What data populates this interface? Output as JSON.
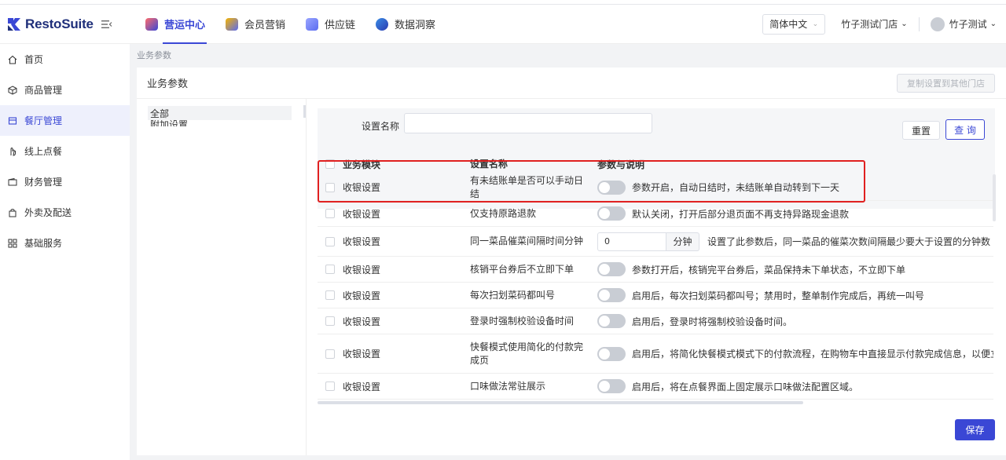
{
  "brand": {
    "name": "RestoSuite"
  },
  "nav": [
    {
      "label": "营运中心",
      "icon": "operations-icon",
      "color": "#3a47d5",
      "active": true
    },
    {
      "label": "会员营销",
      "icon": "member-icon",
      "color": "#f5b400",
      "active": false
    },
    {
      "label": "供应链",
      "icon": "supply-icon",
      "color": "#5b6cf0",
      "active": false
    },
    {
      "label": "数据洞察",
      "icon": "data-icon",
      "color": "#3a8ee6",
      "active": false
    }
  ],
  "header": {
    "language": "简体中文",
    "store": "竹子测试门店",
    "user": "竹子测试"
  },
  "sidebar": {
    "items": [
      {
        "label": "首页",
        "icon": "home-icon"
      },
      {
        "label": "商品管理",
        "icon": "cube-icon"
      },
      {
        "label": "餐厅管理",
        "icon": "restaurant-icon",
        "active": true
      },
      {
        "label": "线上点餐",
        "icon": "hand-icon"
      },
      {
        "label": "财务管理",
        "icon": "wallet-icon"
      },
      {
        "label": "外卖及配送",
        "icon": "bag-icon"
      },
      {
        "label": "基础服务",
        "icon": "grid-icon"
      }
    ]
  },
  "breadcrumb": "业务参数",
  "panel": {
    "title": "业务参数",
    "copy_button": "复制设置到其他门店"
  },
  "categories": {
    "all": "全部",
    "second": "附加设置"
  },
  "filter": {
    "label": "设置名称",
    "input_value": "",
    "reset": "重置",
    "query": "查 询"
  },
  "table": {
    "headers": {
      "module": "业务模块",
      "name": "设置名称",
      "desc": "参数与说明"
    },
    "rows": [
      {
        "module": "收银设置",
        "name": "有未结账单是否可以手动日结",
        "desc": "参数开启，自动日结时，未结账单自动转到下一天",
        "type": "toggle"
      },
      {
        "module": "收银设置",
        "name": "仅支持原路退款",
        "desc": "默认关闭，打开后部分退页面不再支持异路现金退款",
        "type": "toggle"
      },
      {
        "module": "收银设置",
        "name": "同一菜品催菜间隔时间分钟",
        "desc": "设置了此参数后，同一菜品的催菜次数间隔最少要大于设置的分钟数",
        "type": "number",
        "value": "0",
        "unit": "分钟"
      },
      {
        "module": "收银设置",
        "name": "核销平台券后不立即下单",
        "desc": "参数打开后，核销完平台券后，菜品保持未下单状态，不立即下单",
        "type": "toggle"
      },
      {
        "module": "收银设置",
        "name": "每次扫划菜码都叫号",
        "desc": "启用后，每次扫划菜码都叫号；禁用时，整单制作完成后，再统一叫号",
        "type": "toggle"
      },
      {
        "module": "收银设置",
        "name": "登录时强制校验设备时间",
        "desc": "启用后，登录时将强制校验设备时间。",
        "type": "toggle"
      },
      {
        "module": "收银设置",
        "name": "快餐模式使用简化的付款完成页",
        "desc": "启用后，将简化快餐模式模式下的付款流程，在购物车中直接显示付款完成信息，以便立即开",
        "type": "toggle"
      },
      {
        "module": "收银设置",
        "name": "口味做法常驻展示",
        "desc": "启用后，将在点餐界面上固定展示口味做法配置区域。",
        "type": "toggle"
      }
    ]
  },
  "save_button": "保存",
  "colors": {
    "accent": "#3a47d5",
    "highlight": "#e02020"
  }
}
